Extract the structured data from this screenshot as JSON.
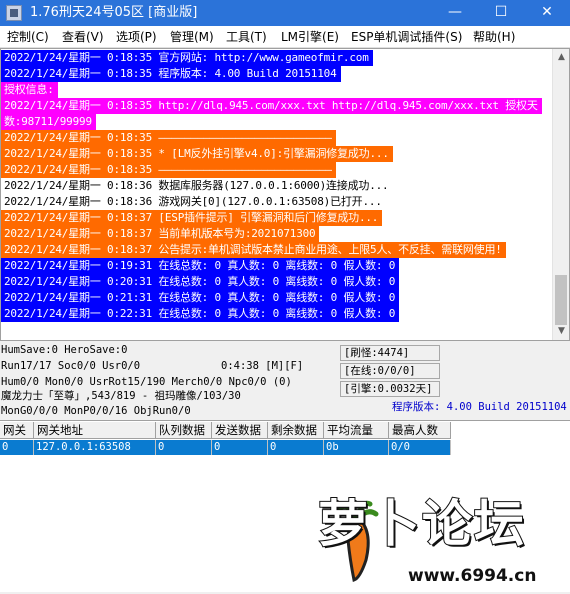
{
  "window": {
    "title": "1.76刑天24号05区 [商业版]",
    "minimize": "—",
    "maximize": "☐",
    "close": "✕"
  },
  "menu": [
    "控制(C)",
    "查看(V)",
    "选项(P)",
    "管理(M)",
    "工具(T)",
    "LM引擎(E)",
    "ESP单机调试插件(S)",
    "帮助(H)"
  ],
  "log": [
    {
      "text": "2022/1/24/星期一 0:18:35 官方网站: http://www.gameofmir.com",
      "fg": "#ffffff",
      "bg": "#0000ff"
    },
    {
      "text": "2022/1/24/星期一 0:18:35 程序版本: 4.00 Build 20151104",
      "fg": "#ffffff",
      "bg": "#0000ff"
    },
    {
      "text": "授权信息:",
      "fg": "#ffffff",
      "bg": "#ff00ff"
    },
    {
      "text": "2022/1/24/星期一 0:18:35 http://dlq.945.com/xxx.txt http://dlq.945.com/xxx.txt 授权天",
      "fg": "#ffffff",
      "bg": "#ff00ff"
    },
    {
      "text": "数:98711/99999",
      "fg": "#ffffff",
      "bg": "#ff00ff"
    },
    {
      "text": "2022/1/24/星期一 0:18:35 ———————————————————————————",
      "fg": "#ffffff",
      "bg": "#ff6a00"
    },
    {
      "text": "2022/1/24/星期一 0:18:35 * [LM反外挂引擎v4.0]:引擎漏洞修复成功...",
      "fg": "#ffffff",
      "bg": "#ff6a00"
    },
    {
      "text": "2022/1/24/星期一 0:18:35 ———————————————————————————",
      "fg": "#ffffff",
      "bg": "#ff6a00"
    },
    {
      "text": "2022/1/24/星期一 0:18:36 数据库服务器(127.0.0.1:6000)连接成功...",
      "fg": "#000000",
      "bg": "#ffffff"
    },
    {
      "text": "2022/1/24/星期一 0:18:36 游戏网关[0](127.0.0.1:63508)已打开...",
      "fg": "#000000",
      "bg": "#ffffff"
    },
    {
      "text": "2022/1/24/星期一 0:18:37 [ESP插件提示] 引擎漏洞和后门修复成功...",
      "fg": "#ffffff",
      "bg": "#ff6a00"
    },
    {
      "text": "2022/1/24/星期一 0:18:37 当前单机版本号为:2021071300",
      "fg": "#ffffff",
      "bg": "#ff6a00"
    },
    {
      "text": "2022/1/24/星期一 0:18:37 公告提示:单机调试版本禁止商业用途、上限5人、不反挂、需联网使用!",
      "fg": "#ffffff",
      "bg": "#ff6a00"
    },
    {
      "text": "2022/1/24/星期一 0:19:31 在线总数: 0 真人数: 0 离线数: 0 假人数: 0",
      "fg": "#ffffff",
      "bg": "#0000ff"
    },
    {
      "text": "2022/1/24/星期一 0:20:31 在线总数: 0 真人数: 0 离线数: 0 假人数: 0",
      "fg": "#ffffff",
      "bg": "#0000ff"
    },
    {
      "text": "2022/1/24/星期一 0:21:31 在线总数: 0 真人数: 0 离线数: 0 假人数: 0",
      "fg": "#ffffff",
      "bg": "#0000ff"
    },
    {
      "text": "2022/1/24/星期一 0:22:31 在线总数: 0 真人数: 0 离线数: 0 假人数: 0",
      "fg": "#ffffff",
      "bg": "#0000ff"
    }
  ],
  "status": {
    "line1": "HumSave:0 HeroSave:0",
    "line2": "Run17/17 Soc0/0 Usr0/0",
    "line2b": "0:4:38 [M][F]",
    "line3": "Hum0/0 Mon0/0 UsrRot15/190 Merch0/0 Npc0/0 (0)",
    "line4": "魔龙力士「至尊」,543/819 - 祖玛雕像/103/30",
    "line5": "MonG0/0/0 MonP0/0/16 ObjRun0/0",
    "refresh": "[刷怪:4474]",
    "online": "[在线:0/0/0]",
    "engine": "[引擎:0.0032天]",
    "version": "程序版本: 4.00 Build 20151104"
  },
  "gateways": {
    "headers": [
      "网关",
      "网关地址",
      "队列数据",
      "发送数据",
      "剩余数据",
      "平均流量",
      "最高人数"
    ],
    "rows": [
      [
        "0",
        "127.0.0.1:63508",
        "0",
        "0",
        "0",
        "0b",
        "0/0"
      ]
    ]
  },
  "watermark": {
    "text": "萝卜论坛",
    "url": "www.6994.cn"
  }
}
